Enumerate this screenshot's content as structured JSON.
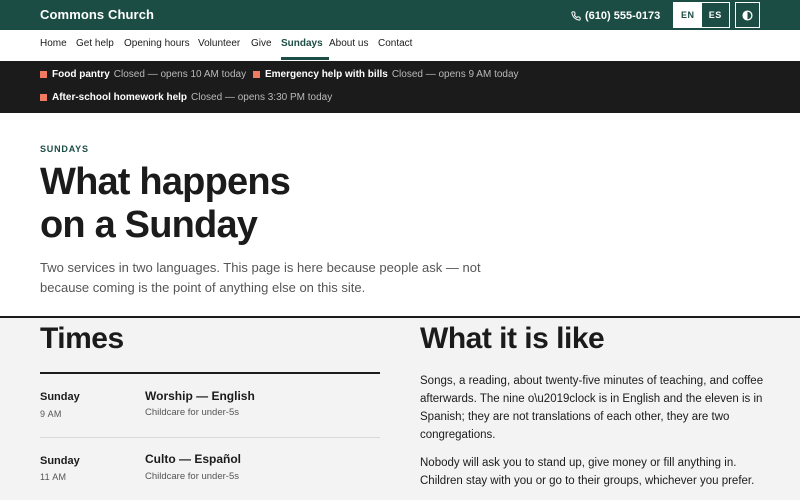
{
  "header": {
    "brand": "Commons Church",
    "phone": "(610) 555-0173",
    "phone_icon": "phone-icon",
    "lang_en": "EN",
    "lang_es": "ES",
    "contrast_icon": "contrast-icon",
    "colors": {
      "brand_green": "#1c4d45",
      "accent": "#f07a62"
    }
  },
  "nav": {
    "items": [
      {
        "label": "Home"
      },
      {
        "label": "Get help"
      },
      {
        "label": "Opening hours"
      },
      {
        "label": "Volunteer"
      },
      {
        "label": "Give"
      },
      {
        "label": "Sundays"
      },
      {
        "label": "About us"
      },
      {
        "label": "Contact"
      }
    ],
    "active": "Sundays"
  },
  "status": [
    {
      "name": "Food pantry",
      "text": "Closed — opens 10 AM today"
    },
    {
      "name": "Emergency help with bills",
      "text": "Closed — opens 9 AM today"
    },
    {
      "name": "After-school homework help",
      "text": "Closed — opens 3:30 PM today"
    }
  ],
  "hero": {
    "eyebrow": "SUNDAYS",
    "title_line1": "What happens",
    "title_line2": "on a Sunday",
    "lead": "Two services in two languages. This page is here because people ask — not because coming is the point of anything else on this site."
  },
  "times": {
    "heading": "Times",
    "rows": [
      {
        "day": "Sunday",
        "time": "9 AM",
        "service": "Worship — English",
        "note": "Childcare for under-5s"
      },
      {
        "day": "Sunday",
        "time": "11 AM",
        "service": "Culto — Español",
        "note": "Childcare for under-5s"
      }
    ]
  },
  "like": {
    "heading": "What it is like",
    "p1": "Songs, a reading, about twenty-five minutes of teaching, and coffee afterwards. The nine o\\u2019clock is in English and the eleven is in Spanish; they are not translations of each other, they are two congregations.",
    "p2": "Nobody will ask you to stand up, give money or fill anything in. Children stay with you or go to their groups, whichever you prefer."
  }
}
